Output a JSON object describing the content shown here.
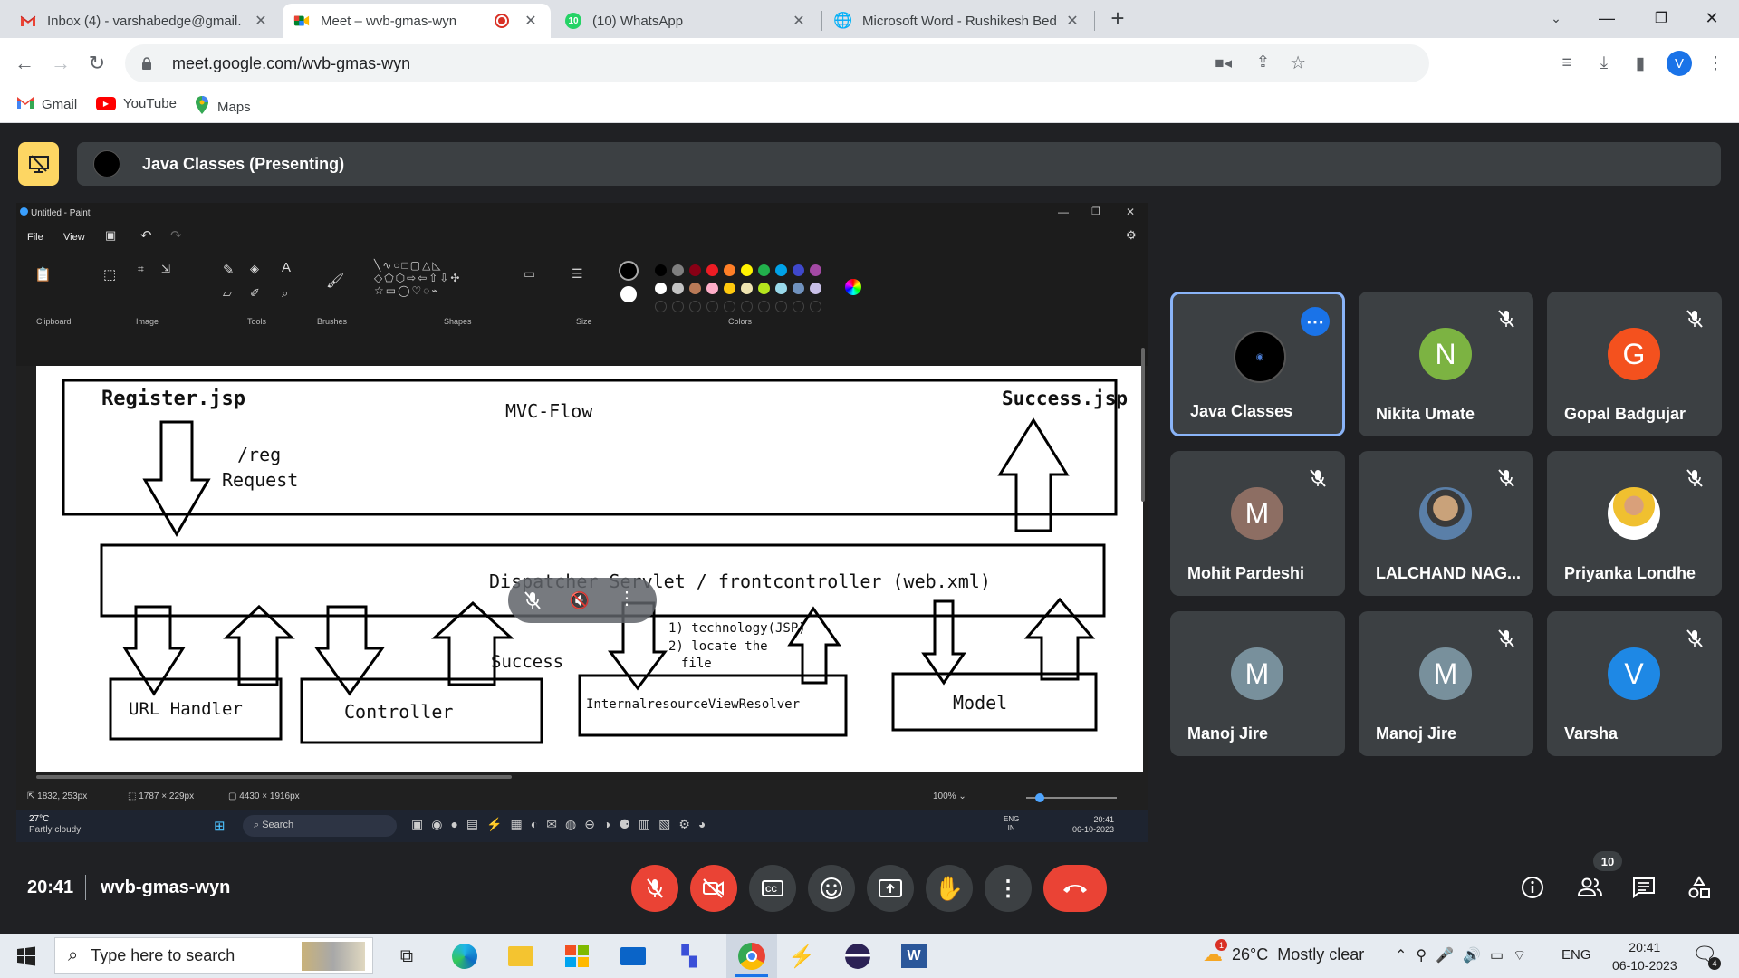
{
  "browser": {
    "tabs": [
      {
        "title": "Inbox (4) - varshabedge@gmail.",
        "icon": "gmail-icon"
      },
      {
        "title": "Meet – wvb-gmas-wyn",
        "icon": "meet-icon",
        "active": true,
        "recording": true
      },
      {
        "title": "(10) WhatsApp",
        "icon": "whatsapp-icon",
        "badge": "10"
      },
      {
        "title": "Microsoft Word - Rushikesh Bed",
        "icon": "globe-icon"
      }
    ],
    "url": "meet.google.com/wvb-gmas-wyn",
    "profile_initial": "V",
    "bookmarks": [
      {
        "label": "Gmail",
        "icon": "gmail-icon"
      },
      {
        "label": "YouTube",
        "icon": "youtube-icon"
      },
      {
        "label": "Maps",
        "icon": "maps-icon"
      }
    ]
  },
  "meet": {
    "presenting_label": "Java Classes (Presenting)",
    "time": "20:41",
    "meeting_code": "wvb-gmas-wyn",
    "people_count": "10",
    "colors": {
      "accent": "#8ab4f8",
      "danger": "#ea4335",
      "tile": "#3c4043",
      "bg": "#202124"
    }
  },
  "participants": [
    {
      "name": "Java Classes",
      "avatar": "logo",
      "color": "#000000",
      "active": true
    },
    {
      "name": "Nikita Umate",
      "initial": "N",
      "color": "#7cb342"
    },
    {
      "name": "Gopal Badgujar",
      "initial": "G",
      "color": "#f4511e"
    },
    {
      "name": "Mohit Pardeshi",
      "initial": "M",
      "color": "#8d6e63"
    },
    {
      "name": "LALCHAND NAG...",
      "avatar": "photo",
      "color": "#9e9e9e"
    },
    {
      "name": "Priyanka Londhe",
      "avatar": "photo",
      "color": "#e0e0e0"
    },
    {
      "name": "Manoj Jire",
      "initial": "M",
      "color": "#78909c"
    },
    {
      "name": "Manoj Jire",
      "initial": "M",
      "color": "#78909c"
    },
    {
      "name": "Varsha",
      "initial": "V",
      "color": "#1e88e5"
    }
  ],
  "paint": {
    "title": "Untitled - Paint",
    "menu": [
      "File",
      "View"
    ],
    "groups": [
      "Clipboard",
      "Image",
      "Tools",
      "Brushes",
      "Shapes",
      "Size",
      "Colors"
    ],
    "status": {
      "pos": "1832, 253px",
      "sel": "1787 × 229px",
      "size": "4430 × 1916px",
      "zoom": "100%"
    }
  },
  "diagram": {
    "title": "MVC-Flow",
    "register": "Register.jsp",
    "success_jsp": "Success.jsp",
    "reg": "/reg",
    "request": "Request",
    "dispatcher": "Dispatcher Servlet / frontcontroller (web.xml)",
    "url_handler": "URL Handler",
    "controller": "Controller",
    "success": "Success",
    "resolver": "InternalresourceViewResolver",
    "model": "Model",
    "note1": "1) technology(JSP)",
    "note2": "2) locate the",
    "note3": "file"
  },
  "remote_taskbar": {
    "weather_temp": "27°C",
    "weather_desc": "Partly cloudy",
    "search": "Search",
    "lang1": "ENG",
    "lang2": "IN",
    "time": "20:41",
    "date": "06-10-2023"
  },
  "taskbar": {
    "search_placeholder": "Type here to search",
    "weather": "26°C  Mostly clear",
    "weather_badge": "1",
    "lang": "ENG",
    "time": "20:41",
    "date": "06-10-2023",
    "notif_count": "4"
  }
}
